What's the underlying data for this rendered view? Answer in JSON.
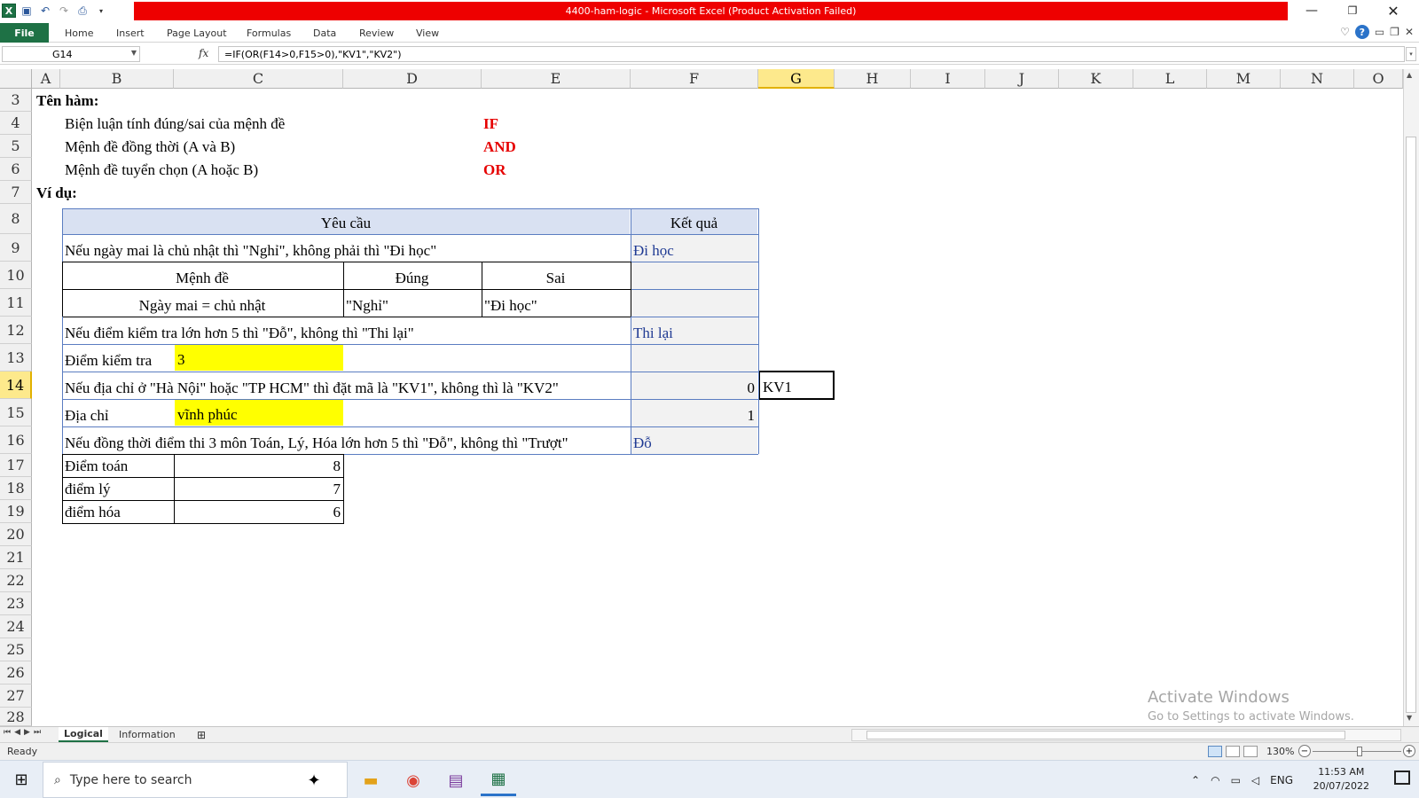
{
  "window": {
    "title": "4400-ham-logic  -  Microsoft Excel (Product Activation Failed)",
    "logo": "X"
  },
  "ribbon": {
    "tabs": [
      "File",
      "Home",
      "Insert",
      "Page Layout",
      "Formulas",
      "Data",
      "Review",
      "View"
    ]
  },
  "formula_bar": {
    "name_box": "G14",
    "fx": "fx",
    "formula": "=IF(OR(F14>0,F15>0),\"KV1\",\"KV2\")"
  },
  "columns": [
    "A",
    "B",
    "C",
    "D",
    "E",
    "F",
    "G",
    "H",
    "I",
    "J",
    "K",
    "L",
    "M",
    "N",
    "O"
  ],
  "selected_column": "G",
  "rows": [
    "3",
    "4",
    "5",
    "6",
    "7",
    "8",
    "9",
    "10",
    "11",
    "12",
    "13",
    "14",
    "15",
    "16",
    "17",
    "18",
    "19",
    "20",
    "21",
    "22",
    "23",
    "24",
    "25",
    "26",
    "27",
    "28"
  ],
  "selected_row": "14",
  "sheet": {
    "r3": "Tên hàm:",
    "r4_desc": "Biện luận tính đúng/sai của mệnh đề",
    "r4_fn": "IF",
    "r5_desc": "Mệnh đề đồng thời (A và B)",
    "r5_fn": "AND",
    "r6_desc": "Mệnh đề tuyển chọn (A hoặc B)",
    "r6_fn": "OR",
    "r7": "Ví dụ:",
    "hdr_req": "Yêu cầu",
    "hdr_res": "Kết quả",
    "r9_req": "Nếu ngày mai là chủ nhật thì \"Nghỉ\", không phải thì \"Đi học\"",
    "r9_res": "Đi học",
    "r10_b": "Mệnh đề",
    "r10_d": "Đúng",
    "r10_e": "Sai",
    "r11_b": "Ngày mai = chủ nhật",
    "r11_d": "\"Nghỉ\"",
    "r11_e": "\"Đi học\"",
    "r12_req": "Nếu điểm kiểm tra lớn hơn 5 thì \"Đỗ\", không thì \"Thi lại\"",
    "r12_res": "Thi lại",
    "r13_b": "Điểm kiểm tra",
    "r13_c": "3",
    "r14_req": "Nếu địa chỉ ở \"Hà Nội\" hoặc \"TP HCM\" thì đặt mã là \"KV1\", không thì là \"KV2\"",
    "r14_f": "0",
    "r14_g": "KV1",
    "r15_b": "Địa chỉ",
    "r15_c": "vĩnh phúc",
    "r15_f": "1",
    "r16_req": "Nếu đồng thời điểm thi 3 môn Toán, Lý, Hóa lớn hơn 5 thì \"Đỗ\", không thì \"Trượt\"",
    "r16_res": "Đỗ",
    "r17_b": "Điểm toán",
    "r17_c": "8",
    "r18_b": "điểm lý",
    "r18_c": "7",
    "r19_b": "điểm hóa",
    "r19_c": "6"
  },
  "sheet_tabs": [
    "Logical",
    "Information"
  ],
  "active_sheet": "Logical",
  "status": {
    "ready": "Ready",
    "zoom": "130%"
  },
  "watermark": {
    "line1": "Activate Windows",
    "line2": "Go to Settings to activate Windows."
  },
  "taskbar": {
    "search_placeholder": "Type here to search",
    "lang": "ENG",
    "time": "11:53 AM",
    "date": "20/07/2022"
  }
}
